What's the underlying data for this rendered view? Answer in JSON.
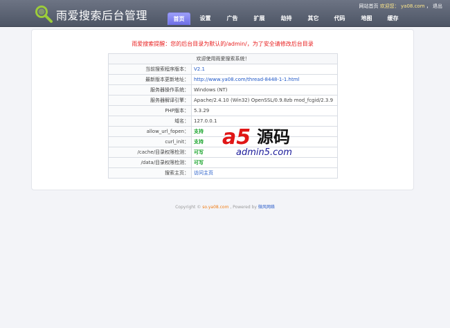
{
  "header": {
    "title": "雨爱搜索后台管理",
    "top_links": {
      "home": "网站首页",
      "welcome": "欢迎您",
      "user": "ya08.com",
      "logout": "退出"
    },
    "nav": [
      {
        "label": "首页",
        "active": true
      },
      {
        "label": "设置",
        "active": false
      },
      {
        "label": "广告",
        "active": false
      },
      {
        "label": "扩展",
        "active": false
      },
      {
        "label": "劫持",
        "active": false
      },
      {
        "label": "其它",
        "active": false
      },
      {
        "label": "代码",
        "active": false
      },
      {
        "label": "地图",
        "active": false
      },
      {
        "label": "缓存",
        "active": false
      }
    ]
  },
  "notice": "雨爱搜索提醒：您的后台目录为默认的/admin/，为了安全请修改后台目录",
  "info": {
    "heading": "欢迎使用雨爱搜索系统！",
    "rows": [
      {
        "key": "当前搜索程序版本：",
        "value": "V2.1"
      },
      {
        "key": "最新版本更新地址：",
        "value": "http://www.ya08.com/thread-8448-1-1.html"
      },
      {
        "key": "服务器操作系统：",
        "value": "Windows (NT)"
      },
      {
        "key": "服务器解译引擎：",
        "value": "Apache/2.4.10 (Win32) OpenSSL/0.9.8zb mod_fcgid/2.3.9"
      },
      {
        "key": "PHP版本：",
        "value": "5.3.29"
      },
      {
        "key": "域名：",
        "value": "127.0.0.1"
      },
      {
        "key": "allow_url_fopen：",
        "value": "支持"
      },
      {
        "key": "curl_init：",
        "value": "支持"
      },
      {
        "key": "/cache/目录权限检测：",
        "value": "可写"
      },
      {
        "key": "/data/目录权限检测：",
        "value": "可写"
      },
      {
        "key": "搜索主页：",
        "value": "访问主页"
      }
    ]
  },
  "watermark": {
    "brand": "a5源码",
    "domain": "admin5.com"
  },
  "footer": {
    "prefix": "Copyright ©",
    "site": "so.ya08.com",
    "powered": ", Powered by",
    "by": "微风网络"
  }
}
